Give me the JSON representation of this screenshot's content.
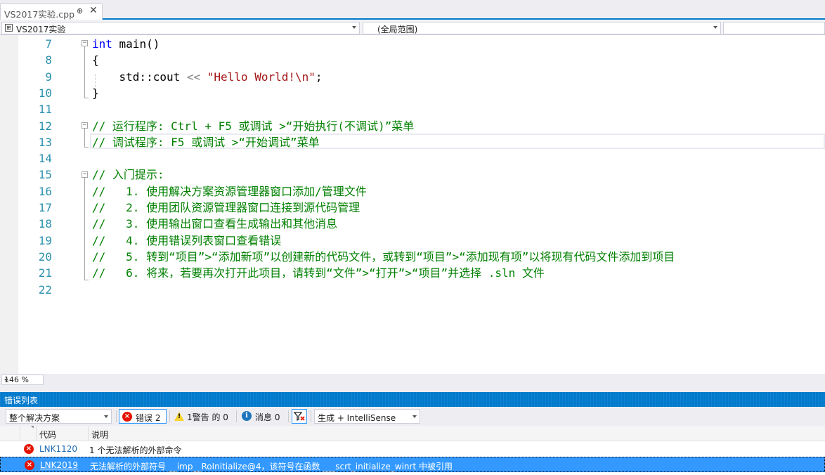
{
  "tab": {
    "title": "VS2017实验.cpp",
    "pin_glyph": "⊕",
    "close_glyph": "✕"
  },
  "navbar": {
    "project": "VS2017实验",
    "scope": "(全局范围)",
    "member": ""
  },
  "editor": {
    "line_numbers": [
      "7",
      "8",
      "9",
      "10",
      "11",
      "12",
      "13",
      "14",
      "15",
      "16",
      "17",
      "18",
      "19",
      "20",
      "21",
      "22"
    ],
    "lines": [
      {
        "parts": [
          {
            "t": "int",
            "c": "kw"
          },
          {
            "t": " main()",
            "c": ""
          }
        ]
      },
      {
        "parts": [
          {
            "t": "{",
            "c": ""
          }
        ]
      },
      {
        "parts": [
          {
            "t": "    std::cout ",
            "c": ""
          },
          {
            "t": "<<",
            "c": "op"
          },
          {
            "t": " ",
            "c": ""
          },
          {
            "t": "\"Hello World!\\n\"",
            "c": "str"
          },
          {
            "t": ";",
            "c": ""
          }
        ]
      },
      {
        "parts": [
          {
            "t": "}",
            "c": ""
          }
        ]
      },
      {
        "parts": []
      },
      {
        "parts": [
          {
            "t": "// 运行程序: Ctrl + F5 或调试 >“开始执行(不调试)”菜单",
            "c": "cm"
          }
        ]
      },
      {
        "parts": [
          {
            "t": "// 调试程序: F5 或调试 >“开始调试”菜单",
            "c": "cm"
          }
        ]
      },
      {
        "parts": []
      },
      {
        "parts": [
          {
            "t": "// 入门提示:",
            "c": "cm"
          }
        ]
      },
      {
        "parts": [
          {
            "t": "//   1. 使用解决方案资源管理器窗口添加/管理文件",
            "c": "cm"
          }
        ]
      },
      {
        "parts": [
          {
            "t": "//   2. 使用团队资源管理器窗口连接到源代码管理",
            "c": "cm"
          }
        ]
      },
      {
        "parts": [
          {
            "t": "//   3. 使用输出窗口查看生成输出和其他消息",
            "c": "cm"
          }
        ]
      },
      {
        "parts": [
          {
            "t": "//   4. 使用错误列表窗口查看错误",
            "c": "cm"
          }
        ]
      },
      {
        "parts": [
          {
            "t": "//   5. 转到“项目”>“添加新项”以创建新的代码文件，或转到“项目”>“添加现有项”以将现有代码文件添加到项目",
            "c": "cm"
          }
        ]
      },
      {
        "parts": [
          {
            "t": "//   6. 将来，若要再次打开此项目，请转到“文件”>“打开”>“项目”并选择 .sln 文件",
            "c": "cm"
          }
        ]
      },
      {
        "parts": []
      }
    ]
  },
  "zoom": "146 %",
  "error_list": {
    "title": "错误列表",
    "scope": "整个解决方案",
    "errors_label": "错误 2",
    "warnings_label": "1警告 的 0",
    "messages_label": "消息 0",
    "build_filter": "生成 + IntelliSense",
    "columns": [
      "代码",
      "说明"
    ],
    "rows": [
      {
        "code": "LNK1120",
        "desc": "1 个无法解析的外部命令"
      },
      {
        "code": "LNK2019",
        "desc": "无法解析的外部符号 __imp__RoInitialize@4，该符号在函数 ___scrt_initialize_winrt 中被引用"
      }
    ]
  },
  "colors": {
    "accent": "#007acc",
    "keyword": "#0000ff",
    "comment": "#008000",
    "string": "#a31515",
    "line_number": "#2b91af",
    "error": "#e51400",
    "selection": "#3399ff"
  }
}
